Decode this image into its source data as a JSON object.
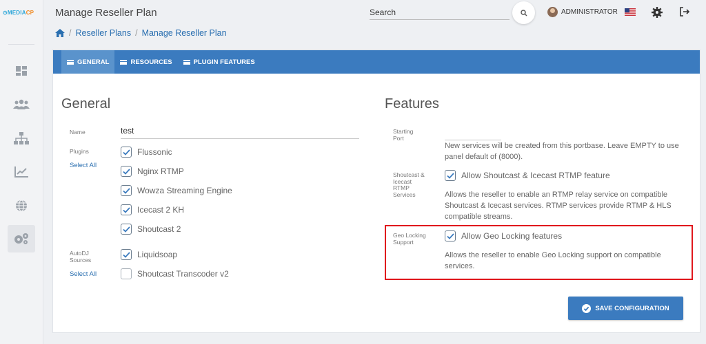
{
  "logo": {
    "part1": "MEDIA",
    "part2": "CP"
  },
  "header": {
    "title": "Manage Reseller Plan",
    "breadcrumb": {
      "level1": "Reseller Plans",
      "level2": "Manage Reseller Plan"
    },
    "search_placeholder": "Search",
    "user_name": "ADMINISTRATOR"
  },
  "sidebar": {
    "items": [
      "dashboard-icon",
      "users-icon",
      "sitemap-icon",
      "chart-icon",
      "globe-icon",
      "settings-icon"
    ],
    "active": "settings-icon"
  },
  "tabs": [
    {
      "label": "GENERAL",
      "active": true
    },
    {
      "label": "RESOURCES",
      "active": false
    },
    {
      "label": "PLUGIN FEATURES",
      "active": false
    }
  ],
  "general": {
    "title": "General",
    "name_label": "Name",
    "name_value": "test",
    "plugins_label": "Plugins",
    "select_all": "Select All",
    "plugins": [
      {
        "label": "Flussonic",
        "checked": true
      },
      {
        "label": "Nginx RTMP",
        "checked": true
      },
      {
        "label": "Wowza Streaming Engine",
        "checked": true
      },
      {
        "label": "Icecast 2 KH",
        "checked": true
      },
      {
        "label": "Shoutcast 2",
        "checked": true
      }
    ],
    "autodj_label_1": "AutoDJ",
    "autodj_label_2": "Sources",
    "autodj": [
      {
        "label": "Liquidsoap",
        "checked": true
      },
      {
        "label": "Shoutcast Transcoder v2",
        "checked": false
      }
    ]
  },
  "features": {
    "title": "Features",
    "starting_port_label_1": "Starting",
    "starting_port_label_2": "Port",
    "starting_port_value": "",
    "starting_port_help_1": "New services will be created from this portbase. Leave EMPTY to use",
    "starting_port_help_2": "panel default of (8000).",
    "shoutcast_label_1": "Shoutcast &",
    "shoutcast_label_2": "Icecast",
    "shoutcast_label_3": "RTMP",
    "shoutcast_label_4": "Services",
    "shoutcast_check": "Allow Shoutcast & Icecast RTMP feature",
    "shoutcast_help_1": "Allows the reseller to enable an RTMP relay service on compatible",
    "shoutcast_help_2": "Shoutcast & Icecast services. RTMP services provide RTMP & HLS",
    "shoutcast_help_3": "compatible streams.",
    "geo_label_1": "Geo Locking",
    "geo_label_2": "Support",
    "geo_check": "Allow Geo Locking features",
    "geo_help_1": "Allows the reseller to enable Geo Locking support on compatible",
    "geo_help_2": "services."
  },
  "save_button": "SAVE CONFIGURATION",
  "colors": {
    "primary": "#3b7bbf",
    "highlight": "#e0171c",
    "sidebar": "#f2f3f5"
  }
}
